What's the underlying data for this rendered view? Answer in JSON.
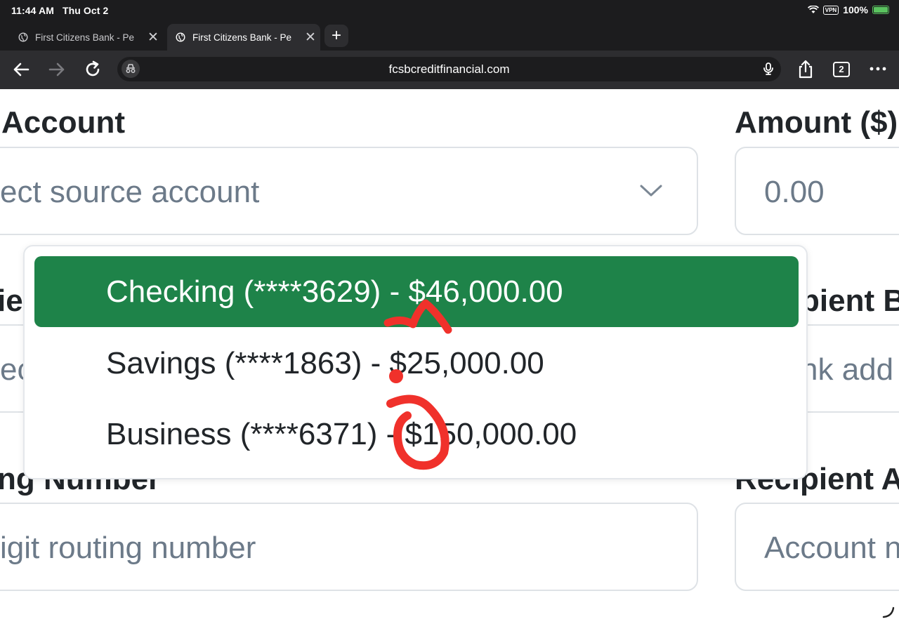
{
  "status_bar": {
    "time": "11:44 AM",
    "date": "Thu Oct 2",
    "vpn": "VPN",
    "battery": "100%"
  },
  "tabs": [
    {
      "title": "First Citizens Bank - Pe",
      "active": false
    },
    {
      "title": "First Citizens Bank - Pe",
      "active": true
    }
  ],
  "toolbar": {
    "url": "fcsbcreditfinancial.com",
    "tab_count": "2"
  },
  "form": {
    "from_account_label": "Account",
    "from_account_placeholder": "ect source account",
    "amount_label": "Amount ($)",
    "amount_placeholder": "0.00",
    "recipient_name_label": "ie",
    "recipient_name_placeholder": "ec",
    "recipient_bank_label": "pient B",
    "recipient_bank_placeholder": "nk add",
    "routing_label": "ng Number",
    "routing_placeholder": "igit routing number",
    "recipient_account_label": "Recipient A",
    "recipient_account_placeholder": "Account n"
  },
  "dropdown": {
    "options": [
      {
        "label": "Checking (****3629) - $46,000.00",
        "selected": true
      },
      {
        "label": "Savings (****1863) - $25,000.00",
        "selected": false
      },
      {
        "label": "Business (****6371) - $150,000.00",
        "selected": false
      }
    ]
  },
  "colors": {
    "selected_option": "#1e8349",
    "chrome_dark": "#1c1c1e",
    "toolbar": "#2d2d30",
    "annotation_red": "#f0312b",
    "field_border": "#dee2e6",
    "placeholder": "#6c7a89"
  },
  "icons": [
    "globe-icon",
    "close-icon",
    "plus-icon",
    "back-arrow-icon",
    "forward-arrow-icon",
    "reload-icon",
    "incognito-icon",
    "mic-icon",
    "share-icon",
    "tabs-icon",
    "more-icon",
    "chevron-down-icon",
    "wifi-icon",
    "battery-icon",
    "resize-handle-icon"
  ]
}
